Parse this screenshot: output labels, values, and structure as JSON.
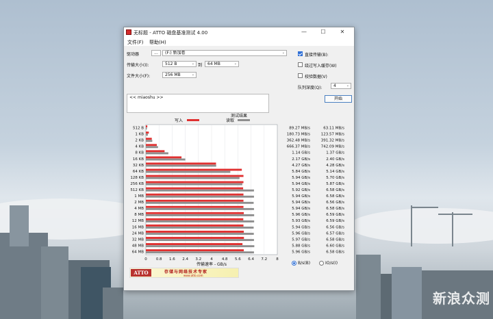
{
  "window": {
    "title": "无标题 - ATTO 磁盘基准测试 4.00",
    "controls": {
      "minimize": "—",
      "maximize": "☐",
      "close": "✕"
    }
  },
  "menu": {
    "file": "文件(F)",
    "help": "帮助(H)"
  },
  "settings": {
    "drive_label": "驱动器",
    "drive_browse": "...",
    "drive_value": "(F:) 新加卷",
    "transfer_label": "传输大小(I):",
    "transfer_from": "512 B",
    "to_label": "到",
    "transfer_to": "64 MB",
    "filesize_label": "文件大小(F):",
    "filesize_value": "256 MB",
    "direct_io_label": "直接传输(B):",
    "direct_io_checked": true,
    "bypass_cache_label": "绕过写入缓存(W)",
    "bypass_cache_checked": false,
    "verify_label": "校验数据(V)",
    "verify_checked": false,
    "queue_label": "队列深度(Q):",
    "queue_value": "4",
    "start_label": "开始"
  },
  "description": "<< miaoshu >>",
  "results": {
    "header": "测试结果",
    "write_legend": "写入",
    "read_legend": "读取",
    "xaxis_label": "传输速率 - GB/s",
    "xticks": [
      "0",
      "0.8",
      "1.6",
      "2.4",
      "3.2",
      "4",
      "4.8",
      "5.6",
      "6.4",
      "7.2",
      "8"
    ],
    "colors": {
      "write": "#e03030",
      "read": "#8e8e8e"
    }
  },
  "units": {
    "bytes": "B/s(B)",
    "bytes_selected": true,
    "io": "IO/s(I)"
  },
  "branding": {
    "logo": "ATTO",
    "slogan": "存储与网络技术专家",
    "url": "www.atto.com"
  },
  "watermark": "新浪众测",
  "chart_data": {
    "type": "bar",
    "orientation": "horizontal",
    "categories": [
      "512 B",
      "1 KB",
      "2 KB",
      "4 KB",
      "8 KB",
      "16 KB",
      "32 KB",
      "64 KB",
      "128 KB",
      "256 KB",
      "512 KB",
      "1 MB",
      "2 MB",
      "4 MB",
      "8 MB",
      "12 MB",
      "16 MB",
      "24 MB",
      "32 MB",
      "48 MB",
      "64 MB"
    ],
    "xlim": [
      0,
      8
    ],
    "xlabel": "传输速率 - GB/s",
    "series": [
      {
        "name": "写入",
        "values": [
          0.089,
          0.181,
          0.362,
          0.666,
          1.14,
          2.17,
          4.27,
          5.84,
          5.94,
          5.94,
          5.92,
          5.94,
          5.94,
          5.94,
          5.96,
          5.93,
          5.94,
          5.96,
          5.97,
          5.88,
          5.96
        ]
      },
      {
        "name": "读取",
        "values": [
          0.063,
          0.124,
          0.391,
          0.742,
          1.37,
          2.4,
          4.28,
          5.14,
          5.7,
          5.87,
          6.58,
          6.58,
          6.56,
          6.58,
          6.59,
          6.59,
          6.56,
          6.57,
          6.58,
          6.6,
          6.58
        ]
      }
    ],
    "write_text": [
      "89.27 MB/s",
      "180.73 MB/s",
      "362.48 MB/s",
      "666.37 MB/s",
      "1.14 GB/s",
      "2.17 GB/s",
      "4.27 GB/s",
      "5.84 GB/s",
      "5.94 GB/s",
      "5.94 GB/s",
      "5.92 GB/s",
      "5.94 GB/s",
      "5.94 GB/s",
      "5.94 GB/s",
      "5.96 GB/s",
      "5.93 GB/s",
      "5.94 GB/s",
      "5.96 GB/s",
      "5.97 GB/s",
      "5.88 GB/s",
      "5.96 GB/s"
    ],
    "read_text": [
      "63.11 MB/s",
      "123.57 MB/s",
      "391.32 MB/s",
      "742.09 MB/s",
      "1.37 GB/s",
      "2.40 GB/s",
      "4.28 GB/s",
      "5.14 GB/s",
      "5.70 GB/s",
      "5.87 GB/s",
      "6.58 GB/s",
      "6.58 GB/s",
      "6.56 GB/s",
      "6.58 GB/s",
      "6.59 GB/s",
      "6.59 GB/s",
      "6.56 GB/s",
      "6.57 GB/s",
      "6.58 GB/s",
      "6.60 GB/s",
      "6.58 GB/s"
    ]
  }
}
